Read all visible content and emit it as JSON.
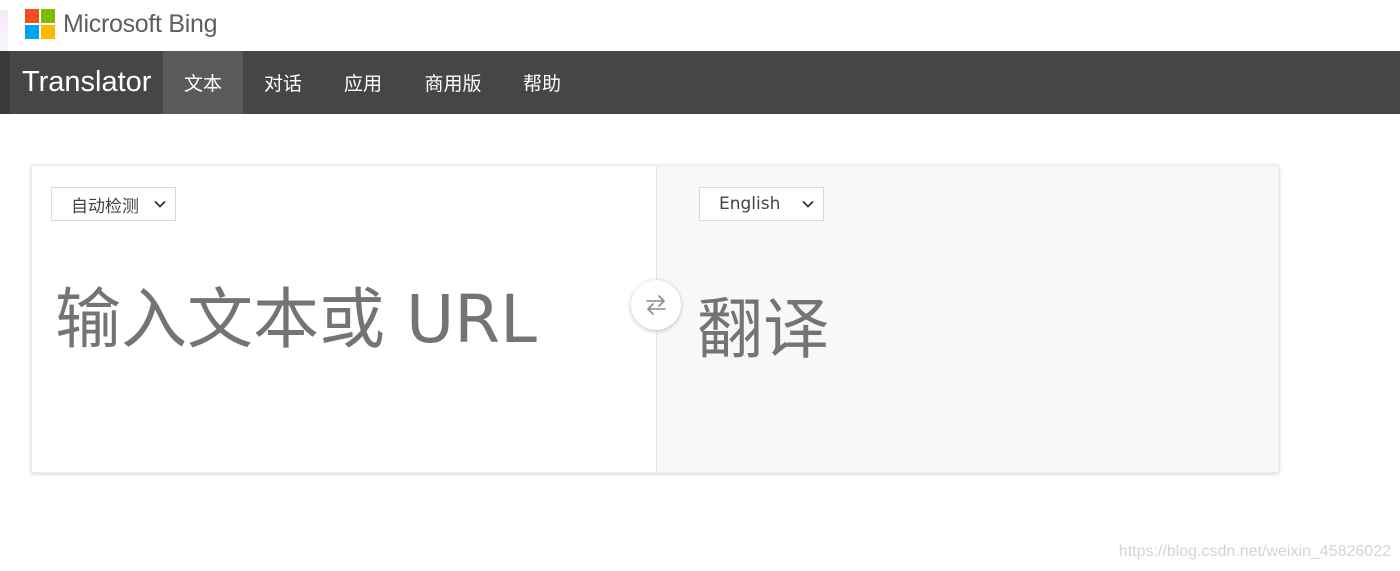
{
  "header": {
    "brand_name": "Microsoft Bing",
    "logo_colors": [
      "#f25022",
      "#7fba00",
      "#00a4ef",
      "#ffb900"
    ]
  },
  "nav": {
    "product_title": "Translator",
    "items": [
      {
        "label": "文本",
        "active": true
      },
      {
        "label": "对话",
        "active": false
      },
      {
        "label": "应用",
        "active": false
      },
      {
        "label": "商用版",
        "active": false
      },
      {
        "label": "帮助",
        "active": false
      }
    ]
  },
  "translator": {
    "source_language": "自动检测",
    "target_language": "English",
    "source_placeholder": "输入文本或 URL",
    "target_placeholder": "翻译",
    "swap_icon": "swap-arrows-icon"
  },
  "watermark": "https://blog.csdn.net/weixin_45826022"
}
